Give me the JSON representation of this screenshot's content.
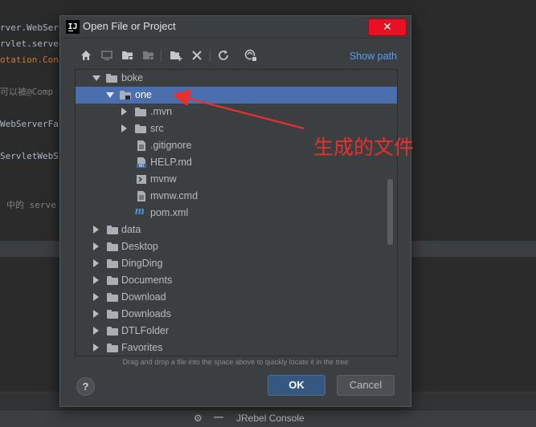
{
  "background": {
    "code_lines": [
      "rver.WebSer",
      "rvlet.serve",
      "otation.Con",
      "可以被@Comp",
      "WebServerFa",
      "ServletWebS",
      "中的 serve"
    ],
    "status_label": "JRebel Console"
  },
  "dialog": {
    "title": "Open File or Project",
    "close_glyph": "✕",
    "show_path_label": "Show path",
    "hint": "Drag and drop a file into the space above to quickly locate it in the tree",
    "help_label": "?",
    "ok_label": "OK",
    "cancel_label": "Cancel"
  },
  "tree": {
    "items": [
      {
        "label": "boke",
        "level": 1,
        "expanded": true,
        "type": "folder"
      },
      {
        "label": "one",
        "level": 2,
        "expanded": true,
        "type": "module-folder",
        "selected": true
      },
      {
        "label": ".mvn",
        "level": 3,
        "expanded": false,
        "type": "folder"
      },
      {
        "label": "src",
        "level": 3,
        "expanded": false,
        "type": "folder"
      },
      {
        "label": ".gitignore",
        "level": 3,
        "type": "text-file"
      },
      {
        "label": "HELP.md",
        "level": 3,
        "type": "md-file"
      },
      {
        "label": "mvnw",
        "level": 3,
        "type": "script-file"
      },
      {
        "label": "mvnw.cmd",
        "level": 3,
        "type": "text-file"
      },
      {
        "label": "pom.xml",
        "level": 3,
        "type": "maven-file"
      },
      {
        "label": "data",
        "level": 0,
        "expanded": false,
        "type": "folder"
      },
      {
        "label": "Desktop",
        "level": 0,
        "expanded": false,
        "type": "folder"
      },
      {
        "label": "DingDing",
        "level": 0,
        "expanded": false,
        "type": "folder"
      },
      {
        "label": "Documents",
        "level": 0,
        "expanded": false,
        "type": "folder"
      },
      {
        "label": "Download",
        "level": 0,
        "expanded": false,
        "type": "folder"
      },
      {
        "label": "Downloads",
        "level": 0,
        "expanded": false,
        "type": "folder"
      },
      {
        "label": "DTLFolder",
        "level": 0,
        "expanded": false,
        "type": "folder"
      },
      {
        "label": "Favorites",
        "level": 0,
        "expanded": false,
        "type": "folder"
      }
    ]
  },
  "annotation": {
    "text": "生成的文件",
    "color": "#e8302c"
  },
  "colors": {
    "selection": "#4b6eaf",
    "link": "#589df6",
    "close": "#e81123"
  }
}
